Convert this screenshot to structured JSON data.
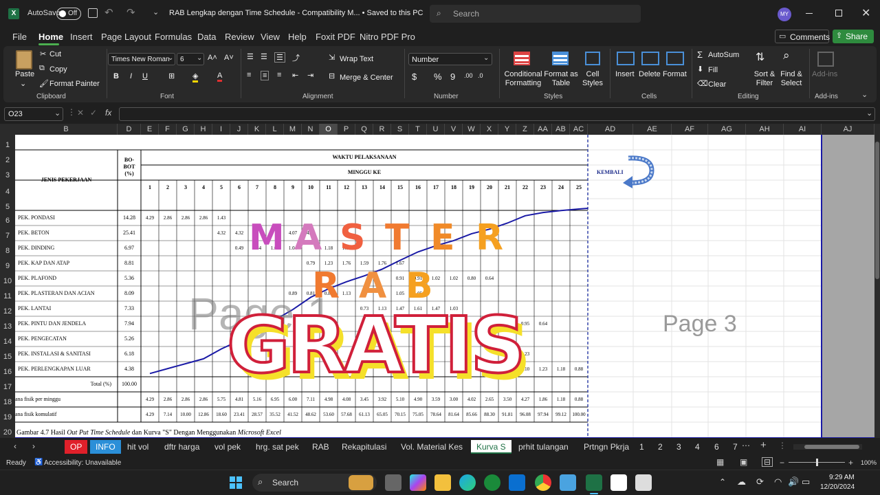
{
  "titlebar": {
    "autosave": "AutoSave",
    "autosave_state": "Off",
    "title": "RAB Lengkap dengan Time Schedule  -  Compatibility M...  •  Saved to this PC",
    "search": "Search",
    "user": "MY"
  },
  "menu": [
    "File",
    "Home",
    "Insert",
    "Page Layout",
    "Formulas",
    "Data",
    "Review",
    "View",
    "Help",
    "Foxit PDF",
    "Nitro PDF Pro"
  ],
  "actions": {
    "comments": "Comments",
    "share": "Share"
  },
  "ribbon": {
    "clipboard": {
      "paste": "Paste",
      "cut": "Cut",
      "copy": "Copy",
      "format_painter": "Format Painter",
      "group": "Clipboard"
    },
    "font": {
      "name": "Times New Roman",
      "size": "6",
      "group": "Font"
    },
    "alignment": {
      "wrap": "Wrap Text",
      "merge": "Merge & Center",
      "group": "Alignment"
    },
    "number": {
      "format": "Number",
      "group": "Number"
    },
    "styles": {
      "cond": "Conditional Formatting",
      "table": "Format as Table",
      "cell": "Cell Styles",
      "group": "Styles"
    },
    "cells": {
      "insert": "Insert",
      "delete": "Delete",
      "format": "Format",
      "group": "Cells"
    },
    "editing": {
      "autosum": "AutoSum",
      "fill": "Fill",
      "clear": "Clear",
      "sort": "Sort & Filter",
      "find": "Find & Select",
      "group": "Editing"
    },
    "addins": {
      "label": "Add-ins",
      "group": "Add-ins"
    }
  },
  "formula": {
    "namebox": "O23",
    "fx": "fx"
  },
  "columns": [
    "B",
    "D",
    "E",
    "F",
    "G",
    "H",
    "I",
    "J",
    "K",
    "L",
    "M",
    "N",
    "O",
    "P",
    "Q",
    "R",
    "S",
    "T",
    "U",
    "V",
    "W",
    "X",
    "Y",
    "Z",
    "AA",
    "AB",
    "AC",
    "AD",
    "AE",
    "AF",
    "AG",
    "AH",
    "AI",
    "AJ"
  ],
  "rows": [
    "1",
    "2",
    "3",
    "4",
    "5",
    "6",
    "7",
    "8",
    "9",
    "10",
    "11",
    "12",
    "13",
    "14",
    "15",
    "16",
    "17",
    "18",
    "19",
    "20"
  ],
  "sheet": {
    "h_jenis": "JENIS PEKERJAAN",
    "h_bobot": "BO-\nBOT\n(%)",
    "h_waktu": "WAKTU PELAKSANAAN",
    "h_minggu": "MINGGU KE",
    "weeks": [
      "1",
      "2",
      "3",
      "4",
      "5",
      "6",
      "7",
      "8",
      "9",
      "10",
      "11",
      "12",
      "13",
      "14",
      "15",
      "16",
      "17",
      "18",
      "19",
      "20",
      "21",
      "22",
      "23",
      "24",
      "25"
    ],
    "tasks": [
      {
        "name": "PEK. PONDASI",
        "bobot": "14.28",
        "vals": [
          [
            "1",
            "4.29"
          ],
          [
            "2",
            "2.86"
          ],
          [
            "3",
            "2.86"
          ],
          [
            "4",
            "2.86"
          ],
          [
            "5",
            "1.43"
          ]
        ]
      },
      {
        "name": "PEK. BETON",
        "bobot": "25.41",
        "vals": [
          [
            "5",
            "4.32"
          ],
          [
            "6",
            "4.32"
          ],
          [
            "9",
            "4.07"
          ],
          [
            "10",
            "4.07"
          ]
        ]
      },
      {
        "name": "PEK. DINDING",
        "bobot": "6.97",
        "vals": [
          [
            "6",
            "0.49"
          ],
          [
            "7",
            "0.84"
          ],
          [
            "8",
            "1.04"
          ],
          [
            "9",
            "1.04"
          ],
          [
            "11",
            "1.18"
          ],
          [
            "12",
            "1.18"
          ]
        ]
      },
      {
        "name": "PEK. KAP DAN ATAP",
        "bobot": "8.81",
        "vals": [
          [
            "10",
            "0.79"
          ],
          [
            "11",
            "1.23"
          ],
          [
            "12",
            "1.76"
          ],
          [
            "13",
            "1.59"
          ],
          [
            "14",
            "1.76"
          ],
          [
            "15",
            "1.67"
          ]
        ]
      },
      {
        "name": "PEK. PLAFOND",
        "bobot": "5.36",
        "vals": [
          [
            "15",
            "0.91"
          ],
          [
            "16",
            "0.91"
          ],
          [
            "17",
            "1.02"
          ],
          [
            "18",
            "1.02"
          ],
          [
            "19",
            "0.80"
          ],
          [
            "20",
            "0.64"
          ]
        ]
      },
      {
        "name": "PEK. PLASTERAN DAN ACIAN",
        "bobot": "8.09",
        "vals": [
          [
            "9",
            "0.89"
          ],
          [
            "10",
            "0.81"
          ],
          [
            "11",
            "0.89"
          ],
          [
            "12",
            "1.13"
          ],
          [
            "15",
            "1.05"
          ],
          [
            "16",
            "1.05"
          ]
        ]
      },
      {
        "name": "PEK. LANTAI",
        "bobot": "7.33",
        "vals": [
          [
            "13",
            "0.73"
          ],
          [
            "14",
            "1.13"
          ],
          [
            "15",
            "1.47"
          ],
          [
            "16",
            "1.61"
          ],
          [
            "17",
            "1.47"
          ],
          [
            "18",
            "1.03"
          ]
        ]
      },
      {
        "name": "PEK. PINTU DAN JENDELA",
        "bobot": "7.94",
        "vals": [
          [
            "22",
            "0.95"
          ],
          [
            "23",
            "0.64"
          ]
        ]
      },
      {
        "name": "PEK. PENGECATAN",
        "bobot": "5.26",
        "vals": []
      },
      {
        "name": "PEK. INSTALASI & SANITASI",
        "bobot": "6.18",
        "vals": [
          [
            "22",
            "2.23"
          ]
        ]
      },
      {
        "name": "PEK. PERLENGKAPAN LUAR",
        "bobot": "4.38",
        "vals": [
          [
            "22",
            "1.10"
          ],
          [
            "23",
            "1.23"
          ],
          [
            "24",
            "1.18"
          ],
          [
            "25",
            "0.88"
          ]
        ]
      }
    ],
    "total_label": "Total  (%)",
    "total": "100.00",
    "per_minggu_label": "ana fisik per minggu",
    "per_minggu": [
      "4.29",
      "2.86",
      "2.86",
      "2.86",
      "5.75",
      "4.81",
      "5.16",
      "6.95",
      "6.00",
      "7.11",
      "4.98",
      "4.08",
      "3.45",
      "3.92",
      "5.10",
      "4.90",
      "3.59",
      "3.00",
      "4.02",
      "2.65",
      "3.50",
      "4.27",
      "1.86",
      "1.18",
      "0.88"
    ],
    "kumulatif_label": "ana fisik komulatif",
    "kumulatif": [
      "4.29",
      "7.14",
      "10.00",
      "12.86",
      "18.60",
      "23.41",
      "28.57",
      "35.52",
      "41.52",
      "48.62",
      "53.60",
      "57.68",
      "61.13",
      "65.05",
      "70.15",
      "75.05",
      "78.64",
      "81.64",
      "85.66",
      "88.30",
      "91.81",
      "96.08",
      "97.94",
      "99.12",
      "100.00"
    ],
    "caption": "Gambar 4.7 Hasil ",
    "caption_i1": "Out Put Time Schedule",
    "caption_2": "  dan Kurva \"S\" Dengan Menggunakan ",
    "caption_i2": "Microsoft Excel",
    "kembali": "KEMBALI",
    "page_label": "Page 3",
    "page_label_ghost": "Page 1"
  },
  "overlay": {
    "master": [
      "M",
      "A",
      "S",
      "T",
      "E",
      "R"
    ],
    "rab": [
      "R",
      "A",
      "B"
    ],
    "gratis": "GRATIS"
  },
  "tabs": {
    "list": [
      "OP",
      "INFO",
      "hit vol",
      "dftr harga",
      "vol pek",
      "hrg. sat pek",
      "RAB",
      "Rekapitulasi",
      "Vol. Material Kes",
      "Kurva S",
      "prhit tulangan",
      "Prtngn Pkrja",
      "1",
      "2",
      "3",
      "4",
      "6",
      "7"
    ],
    "active": "Kurva S"
  },
  "status": {
    "ready": "Ready",
    "access": "Accessibility: Unavailable",
    "zoom": "100%"
  },
  "taskbar": {
    "search": "Search",
    "time": "9:29 AM",
    "date": "12/20/2024"
  },
  "colors": {
    "accent_green": "#1e7145",
    "curve": "#1a1aa6",
    "share": "#2e8b3e",
    "master": [
      "#c84dbd",
      "#d47abd",
      "#f06040",
      "#f07a30",
      "#f08a28",
      "#f5a020"
    ]
  }
}
